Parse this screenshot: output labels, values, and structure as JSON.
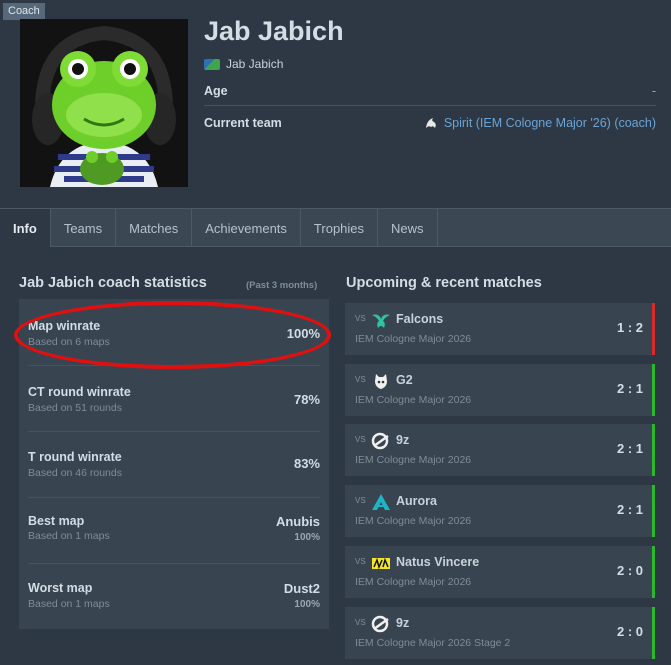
{
  "profile": {
    "role_tag": "Coach",
    "name": "Jab Jabich",
    "nickname": "Jab Jabich",
    "age_label": "Age",
    "age_value": "-",
    "team_label": "Current team",
    "team_value": "Spirit (IEM Cologne Major '26) (coach)"
  },
  "tabs": [
    "Info",
    "Teams",
    "Matches",
    "Achievements",
    "Trophies",
    "News"
  ],
  "stats": {
    "title": "Jab Jabich coach statistics",
    "period": "(Past 3 months)",
    "items": [
      {
        "title": "Map winrate",
        "sub": "Based on 6 maps",
        "value": "100%"
      },
      {
        "title": "CT round winrate",
        "sub": "Based on 51 rounds",
        "value": "78%"
      },
      {
        "title": "T round winrate",
        "sub": "Based on 46 rounds",
        "value": "83%"
      },
      {
        "title": "Best map",
        "sub": "Based on 1 maps",
        "value": "Anubis",
        "value2": "100%"
      },
      {
        "title": "Worst map",
        "sub": "Based on 1 maps",
        "value": "Dust2",
        "value2": "100%"
      }
    ]
  },
  "matches": {
    "title": "Upcoming & recent matches",
    "vs": "VS",
    "items": [
      {
        "team": "Falcons",
        "event": "IEM Cologne Major 2026",
        "score": "1 : 2",
        "result": "loss"
      },
      {
        "team": "G2",
        "event": "IEM Cologne Major 2026",
        "score": "2 : 1",
        "result": "win"
      },
      {
        "team": "9z",
        "event": "IEM Cologne Major 2026",
        "score": "2 : 1",
        "result": "win"
      },
      {
        "team": "Aurora",
        "event": "IEM Cologne Major 2026",
        "score": "2 : 1",
        "result": "win"
      },
      {
        "team": "Natus Vincere",
        "event": "IEM Cologne Major 2026",
        "score": "2 : 0",
        "result": "win"
      },
      {
        "team": "9z",
        "event": "IEM Cologne Major 2026 Stage 2",
        "score": "2 : 0",
        "result": "win"
      }
    ]
  },
  "colors": {
    "win": "#2cb82c",
    "loss": "#d82a2a",
    "highlight": "#e11010",
    "link": "#6aa3d6"
  }
}
